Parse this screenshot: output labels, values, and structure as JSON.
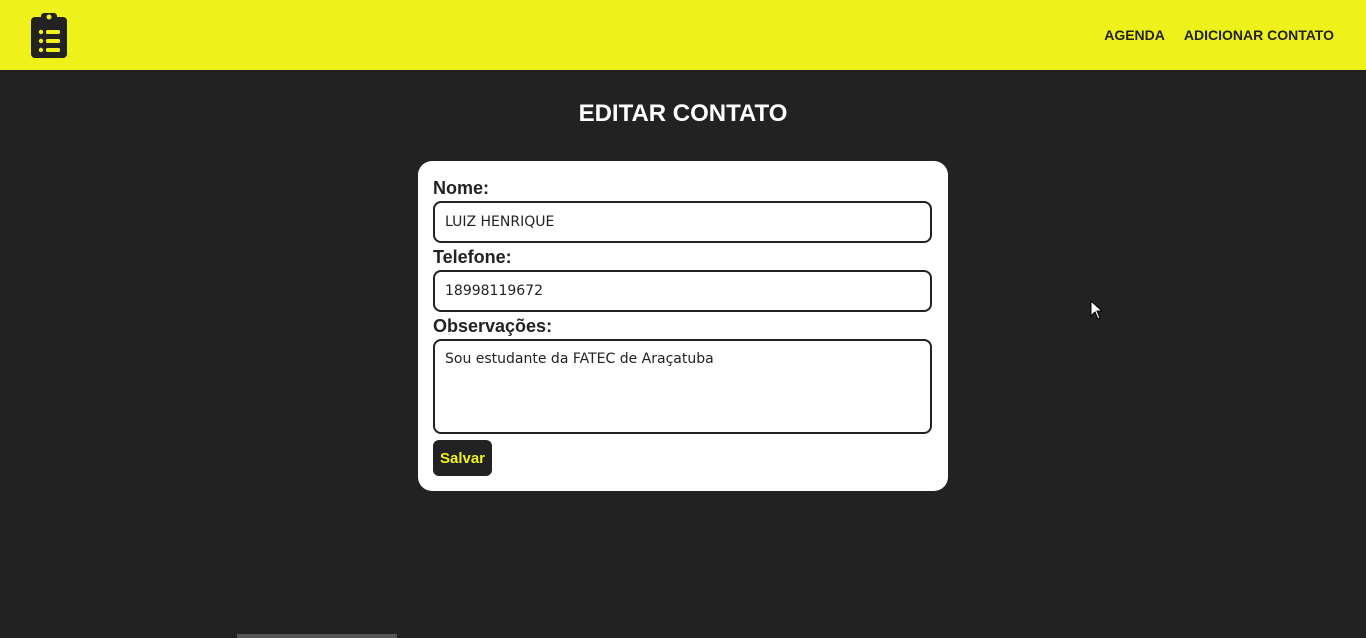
{
  "navbar": {
    "logo_icon": "clipboard-list-icon",
    "links": [
      {
        "label": "AGENDA"
      },
      {
        "label": "ADICIONAR CONTATO"
      }
    ],
    "background_color": "#eef21a"
  },
  "page": {
    "title": "EDITAR CONTATO",
    "background_color": "#222222"
  },
  "form": {
    "nome_label": "Nome:",
    "nome_value": "LUIZ HENRIQUE",
    "telefone_label": "Telefone:",
    "telefone_value": "18998119672",
    "observacoes_label": "Observações:",
    "observacoes_value": "Sou estudante da FATEC de Araçatuba",
    "save_label": "Salvar"
  }
}
